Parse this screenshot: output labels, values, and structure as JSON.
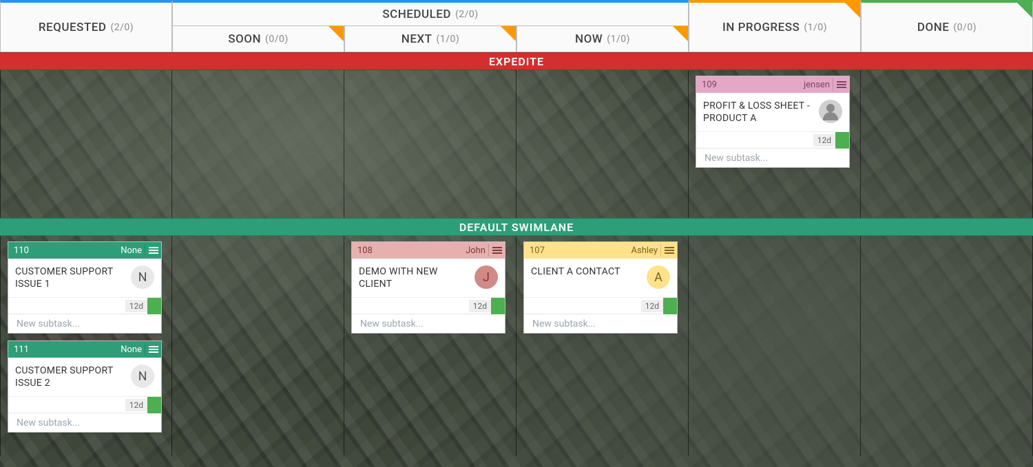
{
  "columns": {
    "requested": {
      "label": "REQUESTED",
      "count": "(2/0)"
    },
    "scheduled": {
      "label": "SCHEDULED",
      "count": "(2/0)"
    },
    "soon": {
      "label": "SOON",
      "count": "(0/0)"
    },
    "next": {
      "label": "NEXT",
      "count": "(1/0)"
    },
    "now": {
      "label": "NOW",
      "count": "(1/0)"
    },
    "in_progress": {
      "label": "IN PROGRESS",
      "count": "(1/0)"
    },
    "done": {
      "label": "DONE",
      "count": "(0/0)"
    }
  },
  "swimlanes": {
    "expedite": {
      "label": "EXPEDITE"
    },
    "default": {
      "label": "DEFAULT SWIMLANE"
    }
  },
  "cards": {
    "c109": {
      "id": "109",
      "owner": "jensen",
      "title": "PROFIT & LOSS SHEET - PRODUCT A",
      "age": "12d",
      "subtask_placeholder": "New subtask..."
    },
    "c110": {
      "id": "110",
      "owner": "None",
      "title": "CUSTOMER SUPPORT ISSUE 1",
      "age": "12d",
      "subtask_placeholder": "New subtask...",
      "avatar_letter": "N"
    },
    "c111": {
      "id": "111",
      "owner": "None",
      "title": "CUSTOMER SUPPORT ISSUE 2",
      "age": "12d",
      "subtask_placeholder": "New subtask...",
      "avatar_letter": "N"
    },
    "c108": {
      "id": "108",
      "owner": "John",
      "title": "DEMO WITH NEW CLIENT",
      "age": "12d",
      "subtask_placeholder": "New subtask...",
      "avatar_letter": "J"
    },
    "c107": {
      "id": "107",
      "owner": "Ashley",
      "title": "CLIENT A CONTACT",
      "age": "12d",
      "subtask_placeholder": "New subtask...",
      "avatar_letter": "A"
    }
  }
}
